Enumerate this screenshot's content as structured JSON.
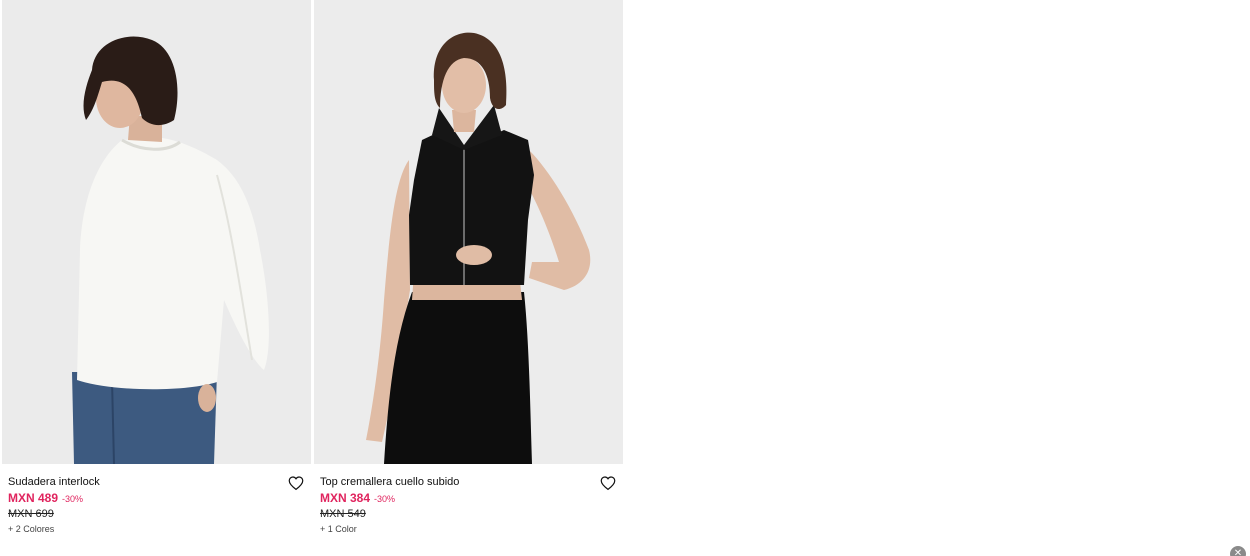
{
  "products": [
    {
      "name": "Sudadera interlock",
      "price": "MXN 489",
      "discount": "-30%",
      "old_price": "MXN 699",
      "colors": "+ 2 Colores",
      "image_icon": "white-sweatshirt-model-photo"
    },
    {
      "name": "Top cremallera cuello subido",
      "price": "MXN 384",
      "discount": "-30%",
      "old_price": "MXN 549",
      "colors": "+ 1 Color",
      "image_icon": "black-zip-top-model-photo"
    }
  ],
  "theme": {
    "sale_color": "#e0245e",
    "photo_bg": "#ececec"
  },
  "icons": {
    "favorite": "heart-outline-icon",
    "close": "close-icon"
  }
}
